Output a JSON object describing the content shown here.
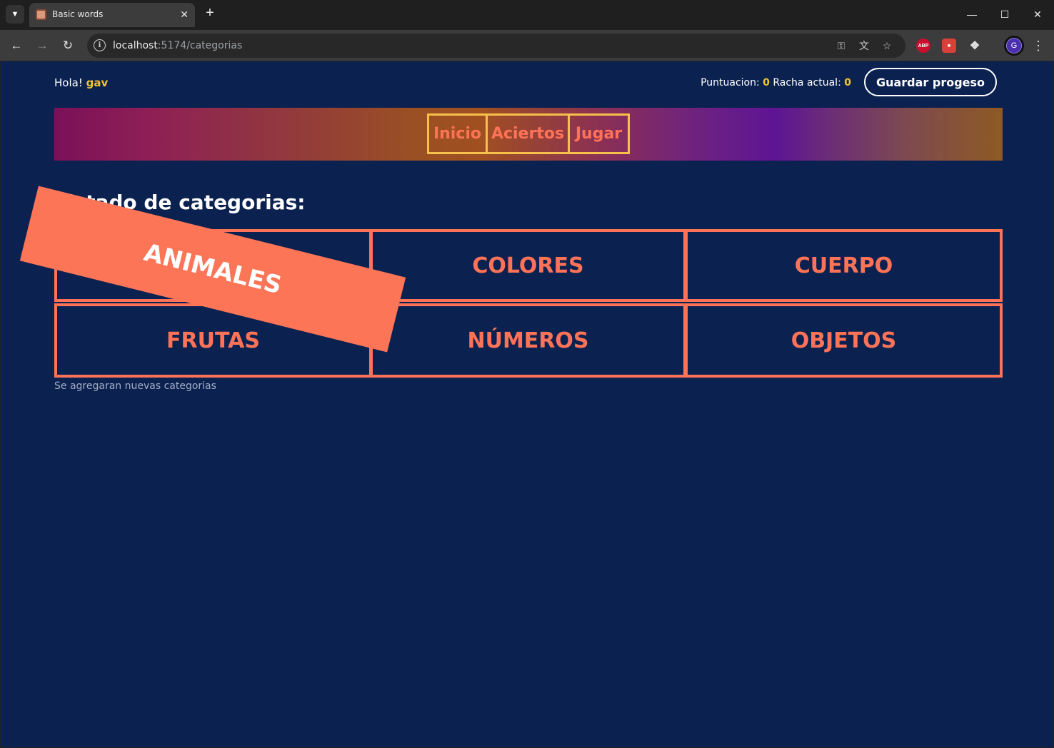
{
  "browser": {
    "tab_title": "Basic words",
    "url_host": "localhost",
    "url_rest": ":5174/categorias",
    "profile_initial": "G",
    "ext_abp_label": "ABP"
  },
  "header": {
    "greeting_label": "Hola!",
    "username": "gav",
    "score_label": "Puntuacion:",
    "score_value": "0",
    "streak_label": "Racha actual:",
    "streak_value": "0",
    "save_button": "Guardar progeso"
  },
  "nav": {
    "items": [
      {
        "label": "Inicio"
      },
      {
        "label": "Aciertos"
      },
      {
        "label": "Jugar"
      }
    ]
  },
  "main": {
    "title": "Listado de categorias:",
    "categories": [
      {
        "label": "ANIMALES"
      },
      {
        "label": "COLORES"
      },
      {
        "label": "CUERPO"
      },
      {
        "label": "FRUTAS"
      },
      {
        "label": "NÚMEROS"
      },
      {
        "label": "OBJETOS"
      }
    ],
    "note": "Se agregaran nuevas categorias"
  },
  "colors": {
    "background": "#0b2150",
    "accent": "#fe7357",
    "highlight": "#f4c430",
    "nav_border": "#f6c14b"
  }
}
